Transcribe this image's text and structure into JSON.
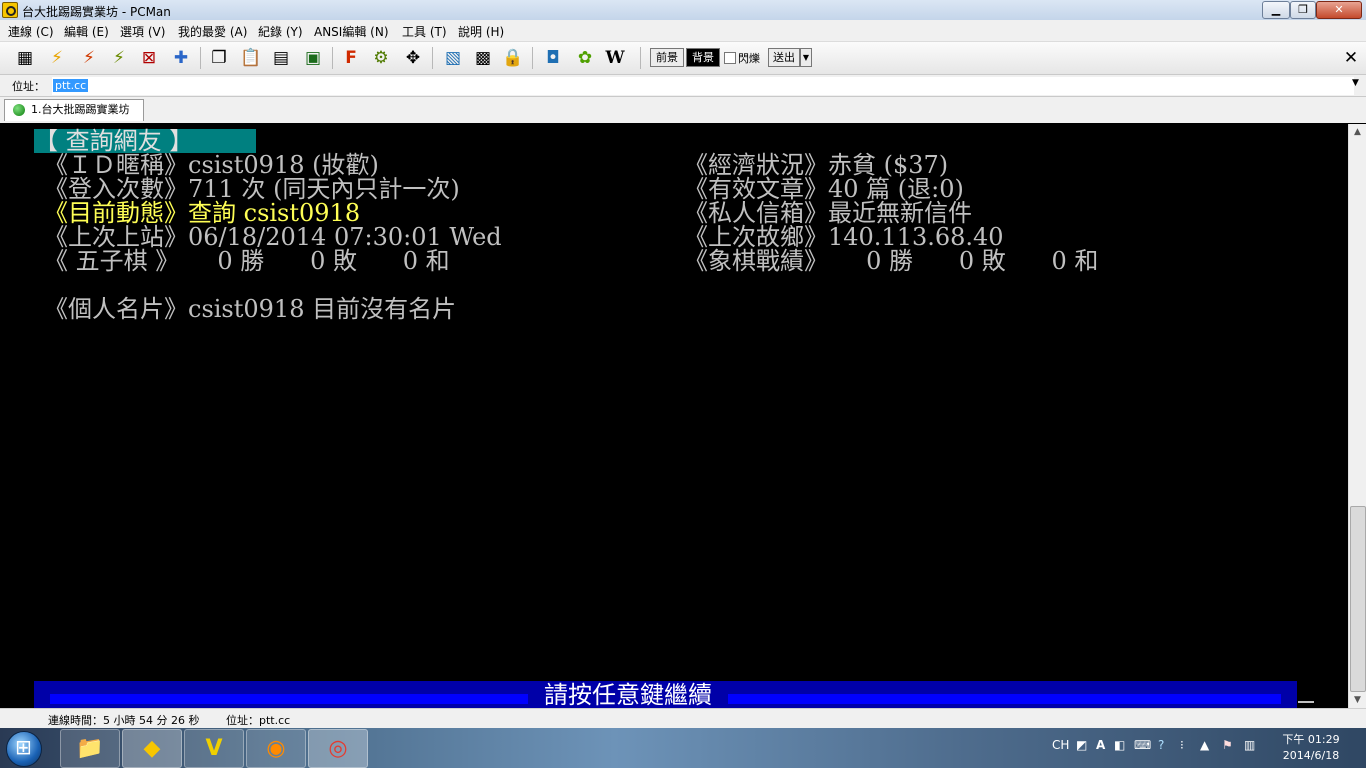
{
  "window": {
    "title": "台大批踢踢實業坊 - PCMan"
  },
  "menu": [
    "連線 (C)",
    "編輯 (E)",
    "選項 (V)",
    "我的最愛 (A)",
    "紀錄 (Y)",
    "ANSI編輯 (N)",
    "工具 (T)",
    "說明 (H)"
  ],
  "toolbar": {
    "fg_label": "前景",
    "bg_label": "背景",
    "blink_label": "閃爍",
    "send_label": "送出"
  },
  "address": {
    "label": "位址：",
    "value": "ptt.cc"
  },
  "tabs": [
    {
      "label": "1.台大批踢踢實業坊"
    }
  ],
  "terminal": {
    "header": "【 查詢網友 】",
    "lines": {
      "id": "《ＩＤ暱稱》csist0918 (妝歡)",
      "econ": "《經濟狀況》赤貧 ($37)",
      "logins": "《登入次數》711 次 (同天內只計一次)",
      "posts": "《有效文章》40 篇 (退:0)",
      "status": "《目前動態》查詢 csist0918",
      "mail": "《私人信箱》最近無新信件",
      "last_login": "《上次上站》06/18/2014 07:30:01 Wed",
      "last_ip": "《上次故鄉》140.113.68.40",
      "gomoku": "《 五子棋 》     0 勝      0 敗      0 和",
      "chess": "《象棋戰績》     0 勝      0 敗      0 和",
      "card": "《個人名片》csist0918 目前沒有名片"
    },
    "footer": "請按任意鍵繼續"
  },
  "status": {
    "connected": "連線時間：5 小時 54 分 26 秒",
    "address": "位址：ptt.cc"
  },
  "tray": {
    "lang": "CH",
    "time": "下午 01:29",
    "date": "2014/6/18"
  }
}
